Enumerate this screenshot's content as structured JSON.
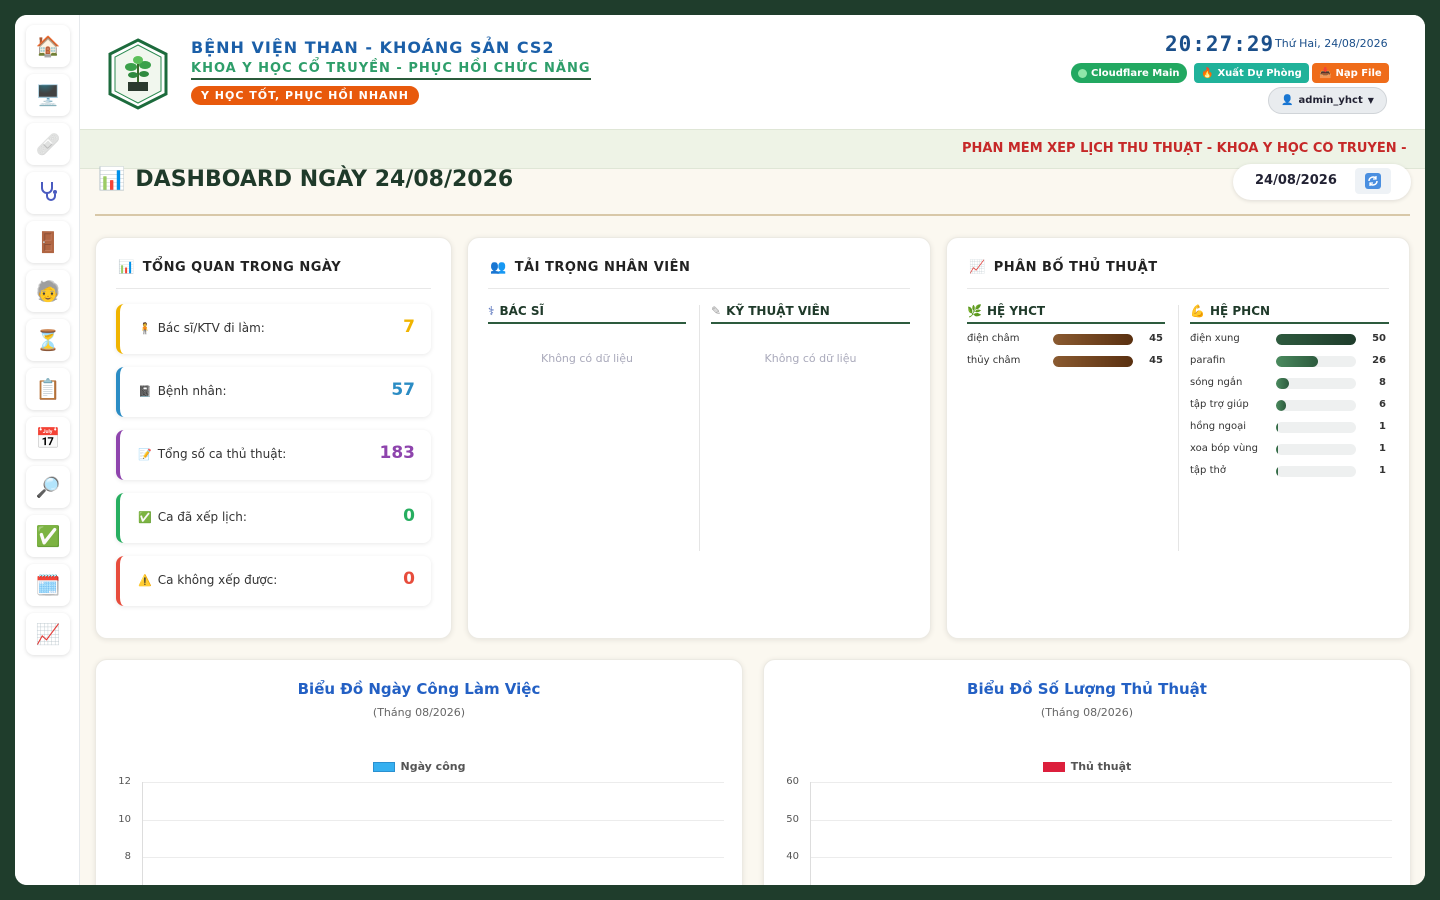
{
  "sidebar": {
    "items": [
      {
        "name": "sidebar-item-home",
        "icon": "home-icon",
        "glyph": "🏠"
      },
      {
        "name": "sidebar-item-computer",
        "icon": "monitor-icon",
        "glyph": "🖥️"
      },
      {
        "name": "sidebar-item-procedures",
        "icon": "bandage-icon",
        "glyph": "🩹"
      },
      {
        "name": "sidebar-item-doctors",
        "icon": "stethoscope-icon",
        "glyph": "stethoscope"
      },
      {
        "name": "sidebar-item-rooms",
        "icon": "door-icon",
        "glyph": "🚪"
      },
      {
        "name": "sidebar-item-patients",
        "icon": "patient-icon",
        "glyph": "🧓"
      },
      {
        "name": "sidebar-item-waiting",
        "icon": "hourglass-icon",
        "glyph": "⏳"
      },
      {
        "name": "sidebar-item-clipboard",
        "icon": "clipboard-icon",
        "glyph": "📋"
      },
      {
        "name": "sidebar-item-calendar",
        "icon": "calendar-icon",
        "glyph": "📅"
      },
      {
        "name": "sidebar-item-search",
        "icon": "search-icon",
        "glyph": "🔎"
      },
      {
        "name": "sidebar-item-check",
        "icon": "check-icon",
        "glyph": "✅"
      },
      {
        "name": "sidebar-item-schedule",
        "icon": "schedule-icon",
        "glyph": "🗓️"
      },
      {
        "name": "sidebar-item-stats",
        "icon": "chart-icon",
        "glyph": "📈"
      }
    ]
  },
  "header": {
    "hospital": "BỆNH VIỆN THAN - KHOÁNG SẢN CS2",
    "department": "KHOA Y HỌC CỔ TRUYỀN - PHỤC HỒI CHỨC NĂNG",
    "slogan": "Y HỌC TỐT, PHỤC HỒI NHANH",
    "clock": "20:27:29",
    "date": "Thứ Hai, 24/08/2026",
    "btn_cloudflare": "Cloudflare Main",
    "btn_export": "Xuất Dự Phòng",
    "btn_load": "Nạp File",
    "user": "admin_yhct",
    "colors": {
      "cloudflare": "#22a861",
      "export": "#20b29a",
      "load": "#ef6c1a"
    }
  },
  "ticker": "PHẦN MỀM XẾP LỊCH THỦ THUẬT - KHOA Y HỌC CỔ TRUYỀN - PHỤC HỒI CHỨC NĂNG",
  "dashboard": {
    "title": "DASHBOARD NGÀY 24/08/2026",
    "date_value": "24/08/2026"
  },
  "overview": {
    "title": "TỔNG QUAN TRONG NGÀY",
    "stats": [
      {
        "label": "Bác sĩ/KTV đi làm:",
        "value": "7",
        "color": "#f0b400"
      },
      {
        "label": "Bệnh nhân:",
        "value": "57",
        "color": "#2b8cc4"
      },
      {
        "label": "Tổng số ca thủ thuật:",
        "value": "183",
        "color": "#8e44ad"
      },
      {
        "label": "Ca đã xếp lịch:",
        "value": "0",
        "color": "#27ae60"
      },
      {
        "label": "Ca không xếp được:",
        "value": "0",
        "color": "#e74c3c"
      }
    ]
  },
  "staff": {
    "title": "TẢI TRỌNG NHÂN VIÊN",
    "doctor": "BÁC SĨ",
    "tech": "KỸ THUẬT VIÊN",
    "empty": "Không có dữ liệu"
  },
  "distribution": {
    "title": "PHÂN BỐ THỦ THUẬT",
    "yhct_title": "HỆ YHCT",
    "phcn_title": "HỆ PHCN",
    "yhct": [
      {
        "name": "điện châm",
        "value": 45
      },
      {
        "name": "thủy châm",
        "value": 45
      }
    ],
    "phcn": [
      {
        "name": "điện xung",
        "value": 50
      },
      {
        "name": "parafin",
        "value": 26
      },
      {
        "name": "sóng ngắn",
        "value": 8
      },
      {
        "name": "tập trợ giúp",
        "value": 6
      },
      {
        "name": "hồng ngoại",
        "value": 1
      },
      {
        "name": "xoa bóp vùng",
        "value": 1
      },
      {
        "name": "tập thở",
        "value": 1
      }
    ]
  },
  "chart_data": [
    {
      "type": "bar",
      "title": "Biểu Đồ Ngày Công Làm Việc",
      "subtitle": "(Tháng 08/2026)",
      "series": [
        {
          "name": "Ngày công",
          "values": []
        }
      ],
      "color": "#36b0f0",
      "yticks": [
        12,
        10,
        8
      ],
      "ylim": [
        0,
        12
      ],
      "grid": true,
      "legend": "top"
    },
    {
      "type": "bar",
      "title": "Biểu Đồ Số Lượng Thủ Thuật",
      "subtitle": "(Tháng 08/2026)",
      "series": [
        {
          "name": "Thủ thuật",
          "values": []
        }
      ],
      "color": "#dc1f3c",
      "yticks": [
        60,
        50,
        40
      ],
      "ylim": [
        0,
        60
      ],
      "grid": true,
      "legend": "top"
    }
  ]
}
